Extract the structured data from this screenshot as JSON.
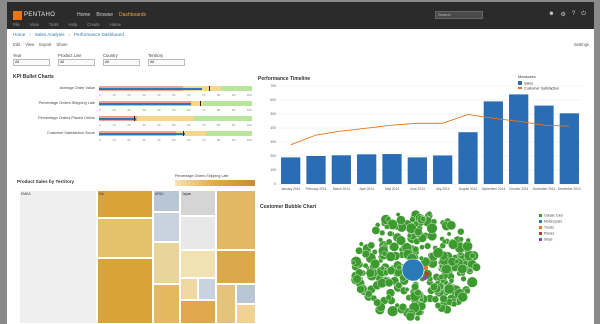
{
  "app": {
    "logo_text": "PENTAHO",
    "nav": [
      "Home",
      "Browse",
      "Dashboards"
    ],
    "active_nav": "Dashboards",
    "subnav": [
      "File",
      "View",
      "Tools",
      "Help",
      "Create",
      "Home"
    ],
    "search_placeholder": "Search",
    "top_icons": [
      "user-icon",
      "settings-icon",
      "help-icon",
      "power-icon"
    ]
  },
  "breadcrumb": [
    "Home",
    "Sales Analysis",
    "Performance Dashboard"
  ],
  "toolbar": {
    "left": [
      "Edit",
      "View",
      "Export",
      "Share"
    ],
    "right": "Settings"
  },
  "filters": [
    {
      "label": "Year",
      "value": "All"
    },
    {
      "label": "Product Line",
      "value": "All"
    },
    {
      "label": "Country",
      "value": "All"
    },
    {
      "label": "Territory",
      "value": "All"
    }
  ],
  "kpi_panel": {
    "title": "KPI Bullet Charts",
    "rows": [
      {
        "label": "Average Order Value",
        "actual": 0.67,
        "target": 0.72,
        "bands": [
          0.55,
          0.8,
          1.0
        ]
      },
      {
        "label": "Percentage Orders Shipping Late",
        "actual": 0.6,
        "target": 0.66,
        "bands": [
          0.6,
          0.68,
          1.0
        ]
      },
      {
        "label": "Percentage Orders Placed Online",
        "actual": 0.24,
        "target": 0.23,
        "bands": [
          0.25,
          0.62,
          1.0
        ]
      },
      {
        "label": "Customer Satisfaction Score",
        "actual": 0.56,
        "target": 0.55,
        "bands": [
          0.5,
          0.7,
          1.0
        ]
      }
    ],
    "ticks": [
      "0",
      "10",
      "20",
      "30",
      "40",
      "50",
      "60",
      "70",
      "80",
      "90",
      "100"
    ]
  },
  "chart_data": [
    {
      "type": "bar",
      "title": "Performance Timeline",
      "categories": [
        "January 2014",
        "February 2014",
        "March 2014",
        "April 2014",
        "May 2014",
        "June 2014",
        "July 2014",
        "August 2014",
        "September 2014",
        "October 2014",
        "November 2014",
        "December 2014"
      ],
      "series": [
        {
          "name": "Sales",
          "type": "bar",
          "values": [
            190,
            200,
            205,
            212,
            214,
            190,
            204,
            370,
            590,
            640,
            560,
            505
          ]
        },
        {
          "name": "Customer Satisfaction",
          "type": "line",
          "values": [
            0.4,
            0.5,
            0.54,
            0.57,
            0.6,
            0.62,
            0.62,
            0.71,
            0.67,
            0.64,
            0.6,
            0.59
          ]
        }
      ],
      "ylim": [
        0,
        700
      ],
      "yticks": [
        "0",
        "100",
        "200",
        "300",
        "400",
        "500",
        "600",
        "700"
      ],
      "y2lim": [
        0,
        1
      ],
      "legend": "top-right",
      "grid": true
    },
    {
      "type": "scatter",
      "title": "Customer Bubble Chart",
      "series": [
        {
          "name": "Classic Cars",
          "color": "#3d9a2f"
        },
        {
          "name": "Motorcycles",
          "color": "#2a7ab8"
        },
        {
          "name": "Trucks",
          "color": "#e8751a"
        },
        {
          "name": "Planes",
          "color": "#c0392b"
        },
        {
          "name": "Ships",
          "color": "#8e44ad"
        }
      ]
    }
  ],
  "timeline_legend": {
    "title": "Measures",
    "items": [
      "Sales",
      "Customer Satisfaction"
    ]
  },
  "treemap": {
    "title": "Product Sales by Territory",
    "legend_label": "Percentage Orders Shipping Late",
    "cells": [
      {
        "label": "EMEA",
        "share": 0.27
      },
      {
        "label": "NA",
        "share": 0.41
      },
      {
        "label": "APAC",
        "share": 0.18
      },
      {
        "label": "Japan",
        "share": 0.14
      }
    ]
  },
  "colors": {
    "topbar": "#2b2b2b",
    "accent": "#e8751a",
    "bar": "#2a6db4",
    "line": "#e8751a",
    "bubble_green": "#3d9a2f",
    "bubble_blue": "#2a7ab8",
    "treemap_gold": "#d8a437",
    "good": "#b9e59a",
    "ok": "#f6d78b",
    "bad": "#f5a08d"
  }
}
